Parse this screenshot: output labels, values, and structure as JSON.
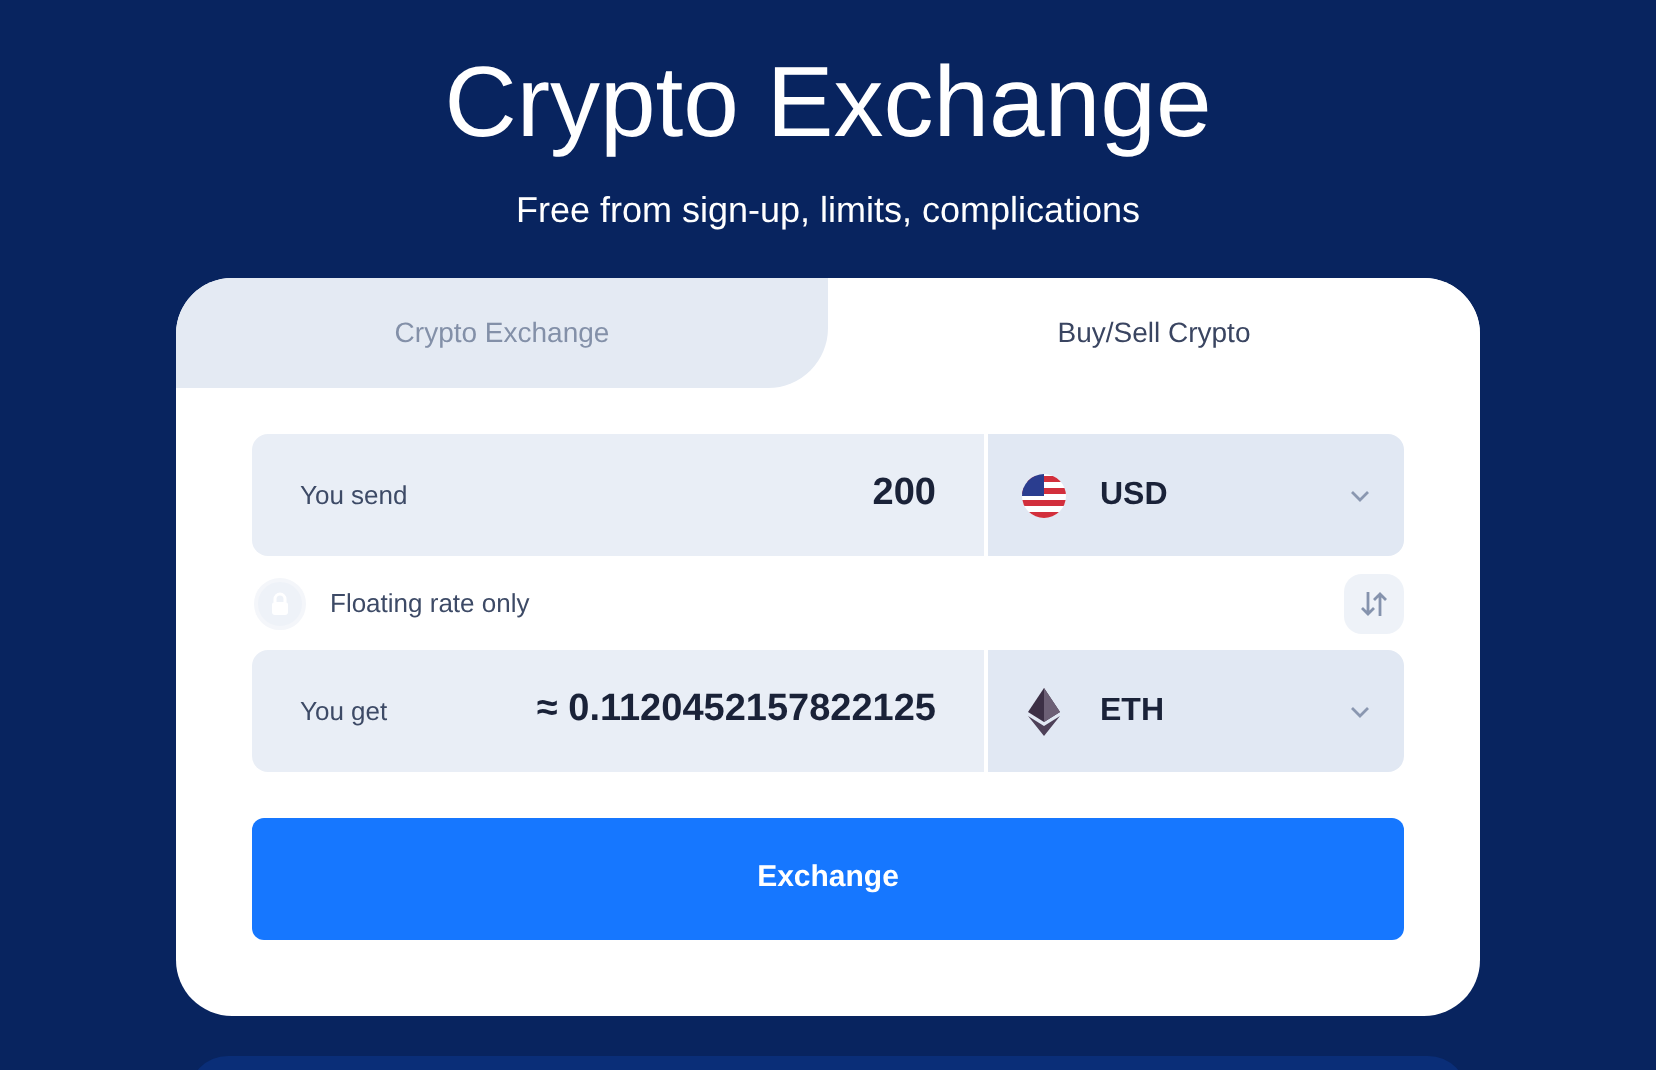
{
  "header": {
    "title": "Crypto Exchange",
    "subtitle": "Free from sign-up, limits, complications"
  },
  "tabs": [
    {
      "label": "Crypto Exchange",
      "selected": false
    },
    {
      "label": "Buy/Sell Crypto",
      "selected": true
    }
  ],
  "send": {
    "label": "You send",
    "value": "200",
    "currency": "USD",
    "kind": "usd"
  },
  "rate_note": "Floating rate only",
  "get": {
    "label": "You get",
    "value": "≈ 0.1120452157822125",
    "currency": "ETH",
    "kind": "eth"
  },
  "button": "Exchange"
}
